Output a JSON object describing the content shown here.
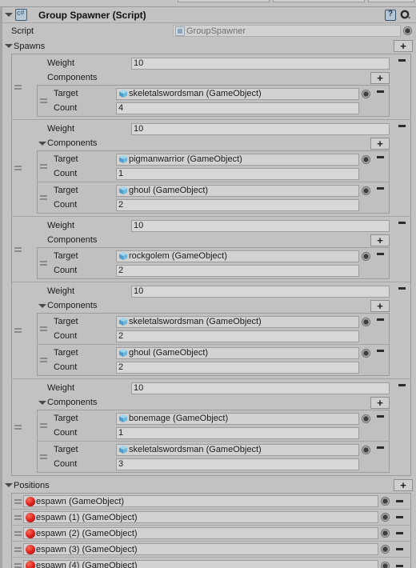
{
  "window": {
    "title": "Group Spawner (Script)",
    "component_icon": "csharp-script-icon",
    "help_icon": "help-icon",
    "settings_icon": "gear-icon",
    "foldout_open": true
  },
  "script_field": {
    "label": "Script",
    "value": "GroupSpawner",
    "icon": "script-asset-icon",
    "disabled": true
  },
  "spawns": {
    "label": "Spawns",
    "add_label": "+",
    "expanded": true,
    "entries": [
      {
        "weight_label": "Weight",
        "weight_value": "10",
        "components_label": "Components",
        "components_expanded": false,
        "components_add_label": "+",
        "remove_label": "−",
        "components": [
          {
            "target_label": "Target",
            "target_value": "skeletalswordsman (GameObject)",
            "target_icon": "gameobject-cube-icon",
            "count_label": "Count",
            "count_value": "4",
            "remove_label": "−"
          }
        ]
      },
      {
        "weight_label": "Weight",
        "weight_value": "10",
        "components_label": "Components",
        "components_expanded": true,
        "components_add_label": "+",
        "remove_label": "−",
        "components": [
          {
            "target_label": "Target",
            "target_value": "pigmanwarrior (GameObject)",
            "target_icon": "gameobject-cube-icon",
            "count_label": "Count",
            "count_value": "1",
            "remove_label": "−"
          },
          {
            "target_label": "Target",
            "target_value": "ghoul (GameObject)",
            "target_icon": "gameobject-cube-icon",
            "count_label": "Count",
            "count_value": "2",
            "remove_label": "−"
          }
        ]
      },
      {
        "weight_label": "Weight",
        "weight_value": "10",
        "components_label": "Components",
        "components_expanded": false,
        "components_add_label": "+",
        "remove_label": "−",
        "components": [
          {
            "target_label": "Target",
            "target_value": "rockgolem (GameObject)",
            "target_icon": "gameobject-cube-icon",
            "count_label": "Count",
            "count_value": "2",
            "remove_label": "−"
          }
        ]
      },
      {
        "weight_label": "Weight",
        "weight_value": "10",
        "components_label": "Components",
        "components_expanded": true,
        "components_add_label": "+",
        "remove_label": "−",
        "components": [
          {
            "target_label": "Target",
            "target_value": "skeletalswordsman (GameObject)",
            "target_icon": "gameobject-cube-icon",
            "count_label": "Count",
            "count_value": "2",
            "remove_label": "−"
          },
          {
            "target_label": "Target",
            "target_value": "ghoul (GameObject)",
            "target_icon": "gameobject-cube-icon",
            "count_label": "Count",
            "count_value": "2",
            "remove_label": "−"
          }
        ]
      },
      {
        "weight_label": "Weight",
        "weight_value": "10",
        "components_label": "Components",
        "components_expanded": true,
        "components_add_label": "+",
        "remove_label": "−",
        "components": [
          {
            "target_label": "Target",
            "target_value": "bonemage (GameObject)",
            "target_icon": "gameobject-cube-icon",
            "count_label": "Count",
            "count_value": "1",
            "remove_label": "−"
          },
          {
            "target_label": "Target",
            "target_value": "skeletalswordsman (GameObject)",
            "target_icon": "gameobject-cube-icon",
            "count_label": "Count",
            "count_value": "3",
            "remove_label": "−"
          }
        ]
      }
    ]
  },
  "positions": {
    "label": "Positions",
    "add_label": "+",
    "expanded": true,
    "entries": [
      {
        "value": "espawn (GameObject)",
        "icon": "prefab-sphere-icon",
        "remove_label": "−"
      },
      {
        "value": "espawn (1) (GameObject)",
        "icon": "prefab-sphere-icon",
        "remove_label": "−"
      },
      {
        "value": "espawn (2) (GameObject)",
        "icon": "prefab-sphere-icon",
        "remove_label": "−"
      },
      {
        "value": "espawn (3) (GameObject)",
        "icon": "prefab-sphere-icon",
        "remove_label": "−"
      },
      {
        "value": "espawn (4) (GameObject)",
        "icon": "prefab-sphere-icon",
        "remove_label": "−"
      }
    ]
  },
  "colors": {
    "background": "#c2c2c2",
    "field_background": "#d7d7d7",
    "border": "#9e9e9e",
    "text": "#1b1b1b",
    "gameobject_icon": "#5aa8d8",
    "prefab_icon": "#d92018"
  }
}
